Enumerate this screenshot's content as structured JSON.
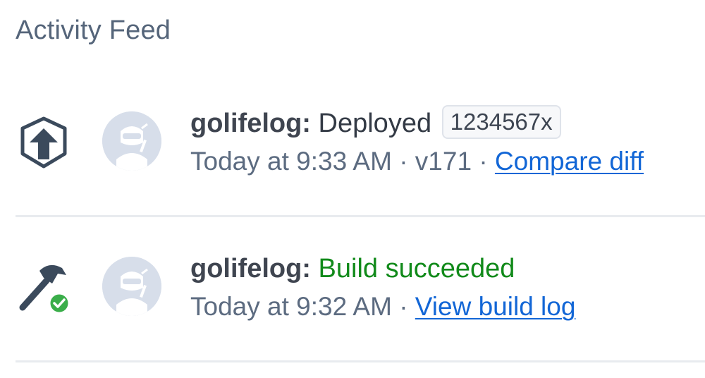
{
  "feed": {
    "title": "Activity Feed"
  },
  "entries": [
    {
      "icon": "deploy-upload-icon",
      "avatar": "ninja-avatar",
      "user": "golifelog:",
      "action": "Deployed",
      "commit": "1234567x",
      "time": "Today at 9:33 AM",
      "separator": "·",
      "version": "v171",
      "link_label": "Compare diff"
    },
    {
      "icon": "hammer-check-icon",
      "avatar": "ninja-avatar",
      "user": "golifelog:",
      "status": "Build succeeded",
      "time": "Today at 9:32 AM",
      "separator": "·",
      "link_label": "View build log"
    }
  ],
  "colors": {
    "title": "#55657a",
    "text": "#333a45",
    "meta": "#5c6b80",
    "link": "#1266d6",
    "success": "#118a1a",
    "avatar_bg": "#d7deea",
    "divider": "#e8ebef"
  }
}
